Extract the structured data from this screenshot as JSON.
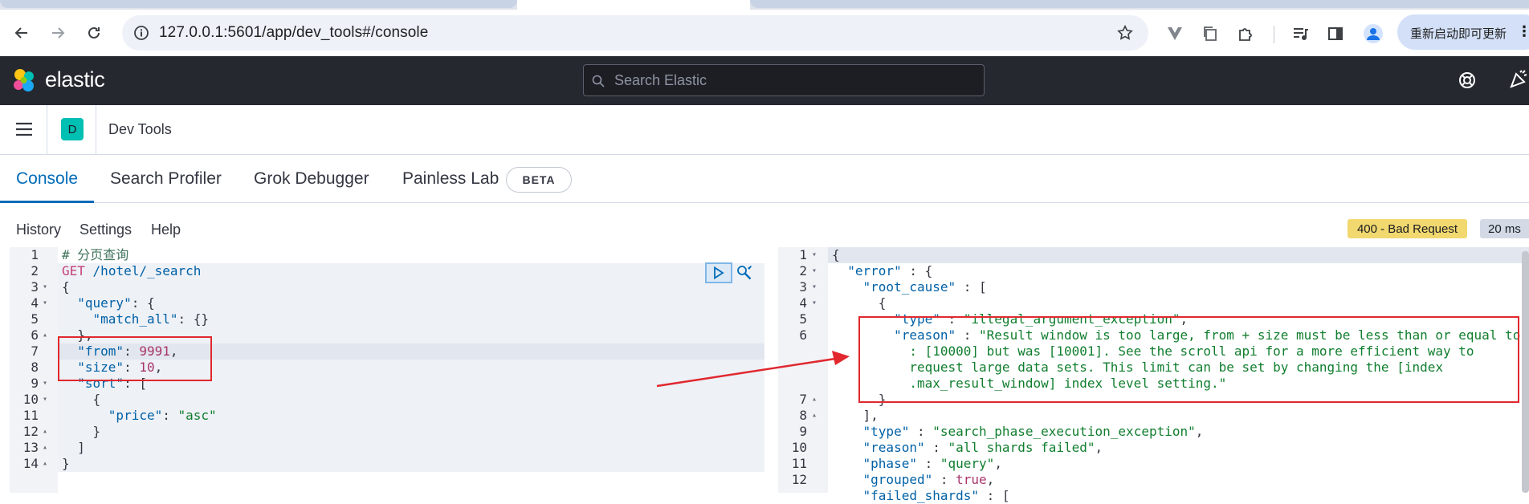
{
  "browser": {
    "url": "127.0.0.1:5601/app/dev_tools#/console",
    "update_label": "重新启动即可更新",
    "back_icon": "arrow-left-icon",
    "forward_icon": "arrow-right-icon",
    "reload_icon": "reload-icon",
    "bookmark_icon": "star-icon"
  },
  "kibana": {
    "brand": "elastic",
    "search_placeholder": "Search Elastic",
    "breadcrumb_space": "D",
    "breadcrumb_title": "Dev Tools",
    "accent": "#006bb8"
  },
  "tabs": [
    {
      "label": "Console",
      "active": true
    },
    {
      "label": "Search Profiler",
      "active": false
    },
    {
      "label": "Grok Debugger",
      "active": false
    },
    {
      "label": "Painless Lab",
      "active": false
    }
  ],
  "beta_label": "BETA",
  "console_menu": [
    "History",
    "Settings",
    "Help"
  ],
  "status": {
    "code_label": "400 - Bad Request",
    "time_label": "20 ms",
    "color": "#f1d86f"
  },
  "request": {
    "lines": [
      {
        "n": "1",
        "fold": false
      },
      {
        "n": "2",
        "fold": false
      },
      {
        "n": "3",
        "fold": true
      },
      {
        "n": "4",
        "fold": true
      },
      {
        "n": "5",
        "fold": false
      },
      {
        "n": "6",
        "fold": true
      },
      {
        "n": "7",
        "fold": false
      },
      {
        "n": "8",
        "fold": false
      },
      {
        "n": "9",
        "fold": true
      },
      {
        "n": "10",
        "fold": true
      },
      {
        "n": "11",
        "fold": false
      },
      {
        "n": "12",
        "fold": true
      },
      {
        "n": "13",
        "fold": true
      },
      {
        "n": "14",
        "fold": true
      }
    ],
    "comment": "# 分页查询",
    "method": "GET",
    "path": "/hotel/_search",
    "query_key": "\"query\"",
    "match_all_key": "\"match_all\"",
    "from_key": "\"from\"",
    "from_value": "9991",
    "size_key": "\"size\"",
    "size_value": "10",
    "sort_key": "\"sort\"",
    "price_key": "\"price\"",
    "price_value": "\"asc\""
  },
  "response": {
    "line_numbers": [
      "1",
      "2",
      "3",
      "4",
      "5",
      "6",
      "7",
      "8",
      "9",
      "10",
      "11",
      "12"
    ],
    "error_key": "\"error\"",
    "root_cause_key": "\"root_cause\"",
    "type_key": "\"type\"",
    "type_value": "\"illegal_argument_exception\"",
    "reason_key": "\"reason\"",
    "reason_lines": [
      "\"Result window is too large, from + size must be less than or equal to",
      ": [10000] but was [10001]. See the scroll api for a more efficient way to",
      "request large data sets. This limit can be set by changing the [index",
      ".max_result_window] index level setting.\""
    ],
    "type2_value": "\"search_phase_execution_exception\"",
    "reason2_value": "\"all shards failed\"",
    "phase_key": "\"phase\"",
    "phase_value": "\"query\"",
    "grouped_key": "\"grouped\"",
    "grouped_value": "true",
    "failed_shards_key": "\"failed_shards\""
  }
}
